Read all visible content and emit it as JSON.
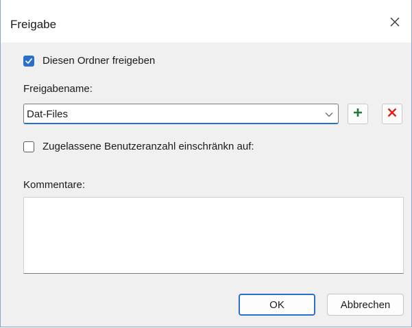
{
  "window": {
    "title": "Freigabe",
    "close_icon": "close-icon"
  },
  "share": {
    "share_folder_label": "Diesen Ordner freigeben",
    "share_folder_checked": true,
    "share_name_label": "Freigabename:",
    "share_name_value": "Dat-Files",
    "add_icon": "plus-icon",
    "remove_icon": "delete-x-icon",
    "limit_users_label": "Zugelassene Benutzeranzahl einschränkn auf:",
    "limit_users_checked": false,
    "comments_label": "Kommentare:",
    "comments_value": ""
  },
  "buttons": {
    "ok_label": "OK",
    "cancel_label": "Abbrechen"
  },
  "colors": {
    "accent": "#2a6fc9",
    "add_green": "#1e7a34",
    "remove_red": "#e0241b"
  }
}
